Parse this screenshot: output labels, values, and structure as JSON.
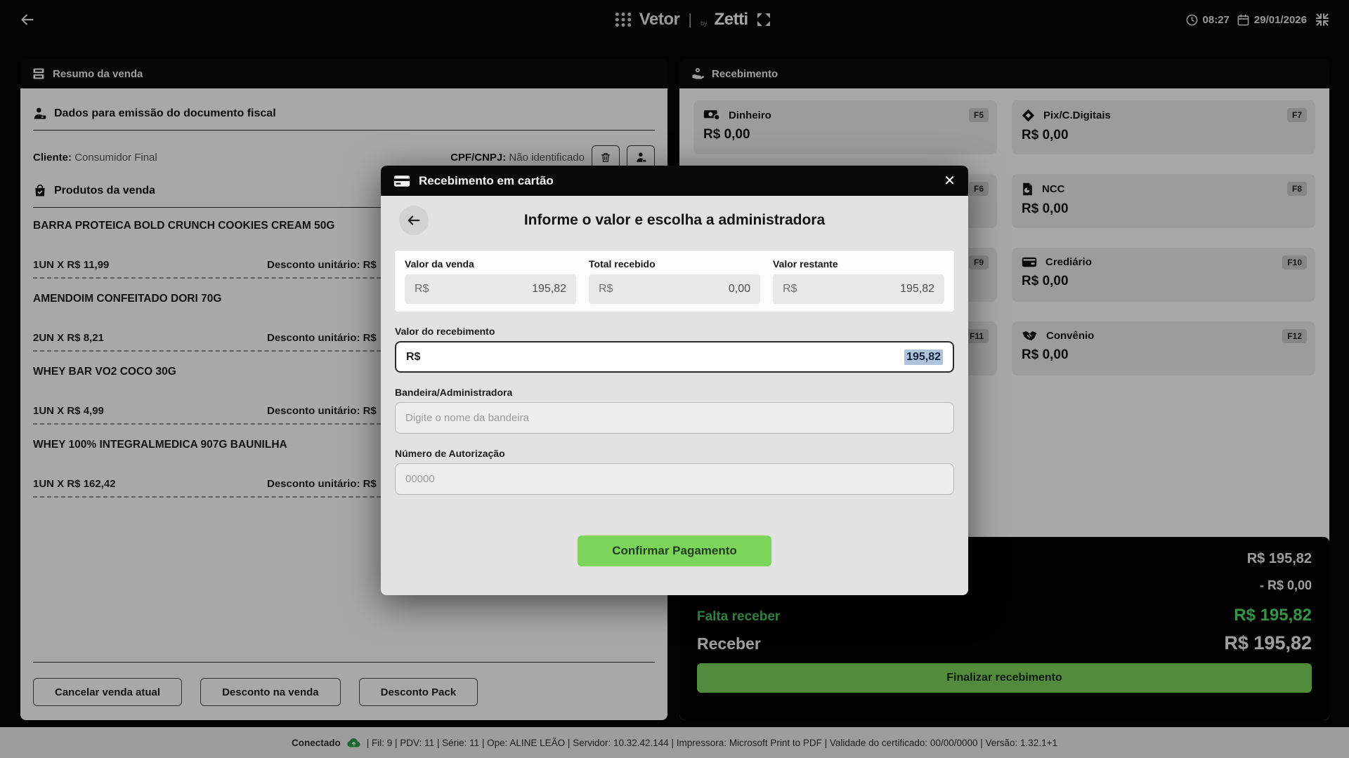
{
  "topbar": {
    "brand_name1": "Vetor",
    "brand_by": "by",
    "brand_name2": "Zetti",
    "time": "08:27",
    "date": "29/01/2026"
  },
  "sale_summary": {
    "title": "Resumo da venda",
    "fiscal_title": "Dados para emissão do documento fiscal",
    "client_label": "Cliente:",
    "client_value": "Consumidor Final",
    "cpf_label": "CPF/CNPJ:",
    "cpf_value": "Não identificado",
    "products_title": "Produtos da venda",
    "products": [
      {
        "name": "BARRA PROTEICA BOLD CRUNCH COOKIES CREAM 50G",
        "qty": "1UN X R$ 11,99",
        "discount": "Desconto unitário: R$"
      },
      {
        "name": "AMENDOIM CONFEITADO DORI 70G",
        "qty": "2UN X R$ 8,21",
        "discount": "Desconto unitário: R$"
      },
      {
        "name": "WHEY BAR VO2 COCO 30G",
        "qty": "1UN X R$ 4,99",
        "discount": "Desconto unitário: R$"
      },
      {
        "name": "WHEY 100% INTEGRALMEDICA 907G BAUNILHA",
        "qty": "1UN X R$ 162,42",
        "discount": "Desconto unitário: R$"
      }
    ],
    "actions": {
      "cancel": "Cancelar venda atual",
      "discount_sale": "Desconto na venda",
      "discount_pack": "Desconto Pack"
    }
  },
  "receiving": {
    "title": "Recebimento",
    "methods": [
      {
        "name": "Dinheiro",
        "key": "F5",
        "value": "R$ 0,00",
        "icon": "cash-icon"
      },
      {
        "name": "Pix/C.Digitais",
        "key": "F7",
        "value": "R$ 0,00",
        "icon": "pix-icon"
      },
      {
        "name": "",
        "key": "F6",
        "value": "",
        "icon": ""
      },
      {
        "name": "NCC",
        "key": "F8",
        "value": "R$ 0,00",
        "icon": "document-icon"
      },
      {
        "name": "",
        "key": "F9",
        "value": "",
        "icon": ""
      },
      {
        "name": "Crediário",
        "key": "F10",
        "value": "R$ 0,00",
        "icon": "wallet-icon"
      },
      {
        "name": "",
        "key": "F11",
        "value": "",
        "icon": ""
      },
      {
        "name": "Convênio",
        "key": "F12",
        "value": "R$ 0,00",
        "icon": "handshake-icon"
      }
    ],
    "summary": {
      "total_value": "R$ 195,82",
      "discount_value": "- R$ 0,00",
      "falta_label": "Falta receber",
      "falta_value": "R$ 195,82",
      "receber_label": "Receber",
      "receber_value": "R$ 195,82",
      "finalize_label": "Finalizar recebimento"
    }
  },
  "modal": {
    "header_title": "Recebimento em cartão",
    "title": "Informe o valor e escolha a administradora",
    "currency_prefix": "R$",
    "valor_venda_label": "Valor da venda",
    "valor_venda_value": "195,82",
    "total_recebido_label": "Total recebido",
    "total_recebido_value": "0,00",
    "valor_restante_label": "Valor restante",
    "valor_restante_value": "195,82",
    "recebimento_label": "Valor do recebimento",
    "recebimento_value": "195,82",
    "bandeira_label": "Bandeira/Administradora",
    "bandeira_placeholder": "Digite o nome da bandeira",
    "autorizacao_label": "Número de Autorização",
    "autorizacao_placeholder": "00000",
    "confirm_label": "Confirmar Pagamento"
  },
  "statusbar": {
    "connected": "Conectado",
    "details": "| Fil: 9 | PDV: 11 | Série: 11 | Ope: ALINE LEÃO | Servidor: 10.32.42.144 | Impressora: Microsoft Print to PDF | Validade do certificado: 00/00/0000 | Versão: 1.32.1+1"
  },
  "colors": {
    "accent_green": "#7cd45a",
    "green_text": "#52e06e",
    "selection_blue": "#aec3dc"
  }
}
